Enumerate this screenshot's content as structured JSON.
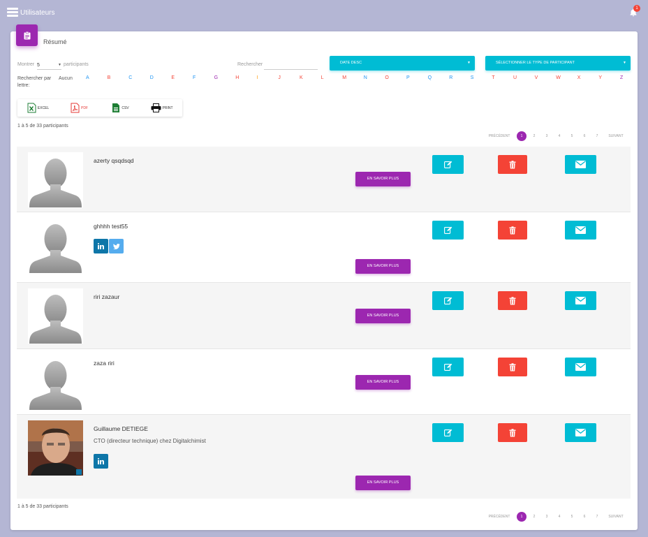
{
  "app": {
    "title": "Utilisateurs",
    "notifications": "1"
  },
  "card": {
    "title": "Résumé"
  },
  "controls": {
    "show_label": "Montrer",
    "show_value": "5",
    "participants_label": "participants",
    "search_label": "Rechercher",
    "search_value": "",
    "sort_dropdown": "DATE DESC",
    "type_dropdown": "SÉLECTIONNER LE TYPE DE PARTICIPANT",
    "letter_label_1": "Rechercher par",
    "letter_label_2": "lettre:",
    "letter_none": "Aucun"
  },
  "letters": [
    "A",
    "B",
    "C",
    "D",
    "E",
    "F",
    "G",
    "H",
    "I",
    "J",
    "K",
    "L",
    "M",
    "N",
    "O",
    "P",
    "Q",
    "R",
    "S",
    "T",
    "U",
    "V",
    "W",
    "X",
    "Y",
    "Z"
  ],
  "letter_colors": {
    "blue": "#2196f3",
    "red": "#f44336",
    "purple": "#9c27b0",
    "orange": "#ff9800"
  },
  "exports": {
    "excel": "EXCEL",
    "pdf": "PDF",
    "csv": "CSV",
    "print": "PRINT"
  },
  "count_text": "1 à 5 de 33 participants",
  "pagination": {
    "prev": "PRÉCÉDENT",
    "next": "SUIVANT",
    "pages": [
      "1",
      "2",
      "3",
      "4",
      "5",
      "6",
      "7"
    ],
    "current": "1"
  },
  "more_label": "EN SAVOIR PLUS",
  "participants": [
    {
      "name": "azerty qsqdsqd",
      "subtitle": "",
      "social": []
    },
    {
      "name": "ghhhh test55",
      "subtitle": "",
      "social": [
        "linkedin",
        "twitter"
      ]
    },
    {
      "name": "riri zazaur",
      "subtitle": "",
      "social": []
    },
    {
      "name": "zaza riri",
      "subtitle": "",
      "social": []
    },
    {
      "name": "Guillaume DETIEGE",
      "subtitle": "CTO (directeur technique) chez Digitalchimist",
      "social": [
        "linkedin"
      ]
    }
  ],
  "colors": {
    "primary": "#9c27b0",
    "info": "#00bcd4",
    "danger": "#f44336",
    "linkedin": "#0e76a8",
    "twitter": "#55acee"
  }
}
